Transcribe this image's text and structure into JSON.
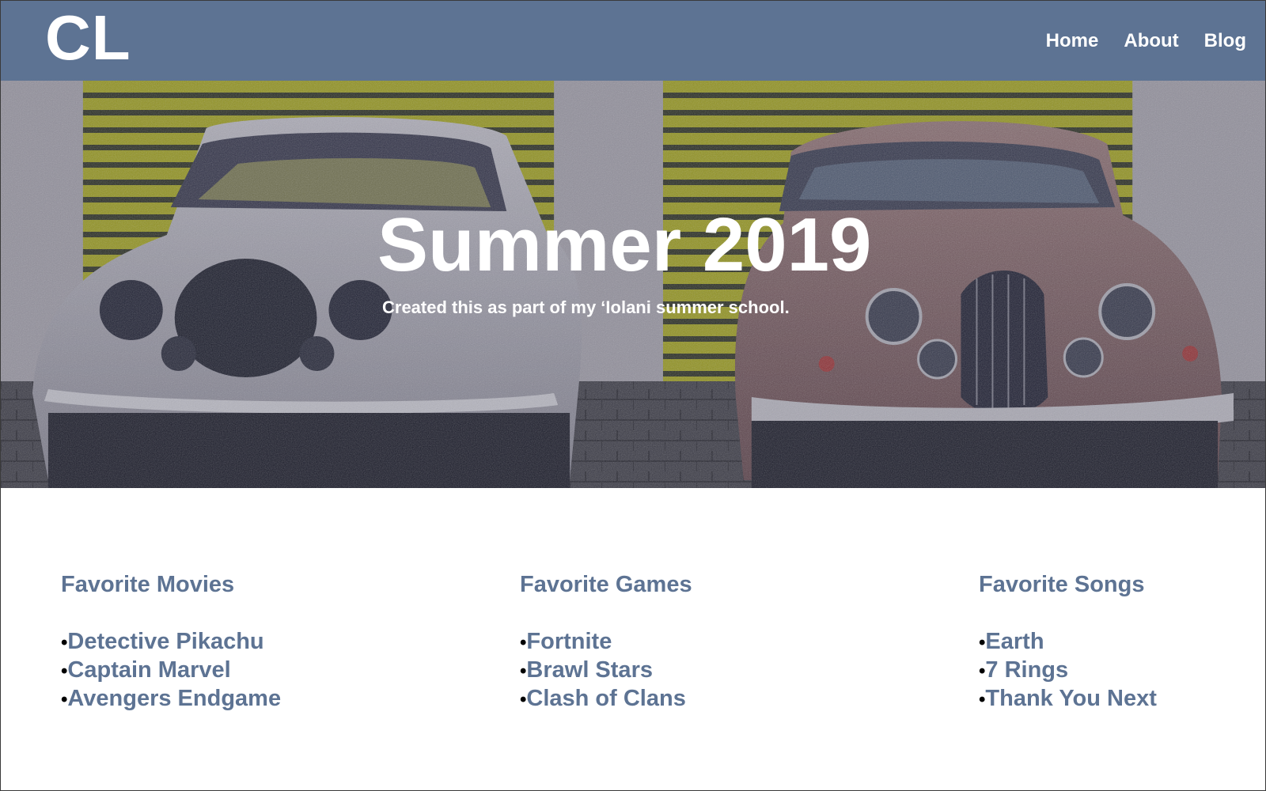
{
  "header": {
    "logo": "CL",
    "nav": [
      "Home",
      "About",
      "Blog"
    ]
  },
  "hero": {
    "title": "Summer 2019",
    "subtitle": "Created this as part of my ʻIolani summer school."
  },
  "lists": [
    {
      "heading": "Favorite Movies",
      "items": [
        "Detective Pikachu",
        "Captain Marvel",
        "Avengers Endgame"
      ]
    },
    {
      "heading": "Favorite Games",
      "items": [
        "Fortnite",
        "Brawl Stars",
        "Clash of Clans"
      ]
    },
    {
      "heading": "Favorite Songs",
      "items": [
        "Earth",
        "7 Rings",
        "Thank You Next"
      ]
    }
  ],
  "bullet": "•",
  "colors": {
    "brand": "#5d7393",
    "hero_text": "#ffffff"
  }
}
